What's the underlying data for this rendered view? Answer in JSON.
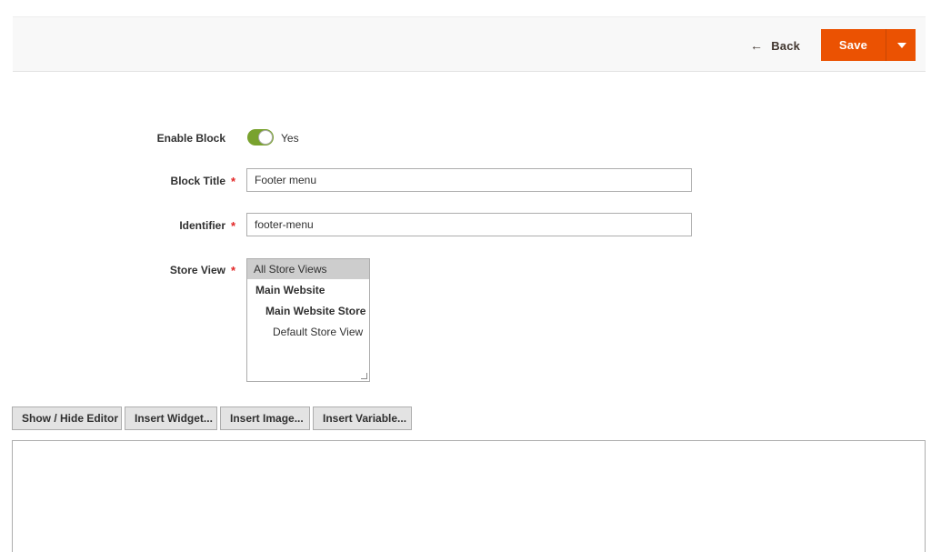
{
  "header": {
    "back_label": "Back",
    "save_label": "Save"
  },
  "form": {
    "enable_block": {
      "label": "Enable Block",
      "value_label": "Yes",
      "enabled": true
    },
    "block_title": {
      "label": "Block Title",
      "required_mark": "*",
      "value": "Footer menu"
    },
    "identifier": {
      "label": "Identifier",
      "required_mark": "*",
      "value": "footer-menu"
    },
    "store_view": {
      "label": "Store View",
      "required_mark": "*",
      "options": [
        {
          "label": "All Store Views",
          "selected": true
        },
        {
          "label": "Main Website"
        },
        {
          "label": "Main Website Store"
        },
        {
          "label": "Default Store View"
        }
      ]
    }
  },
  "editor": {
    "buttons": [
      "Show / Hide Editor",
      "Insert Widget...",
      "Insert Image...",
      "Insert Variable..."
    ]
  },
  "colors": {
    "accent": "#eb5202",
    "toggle_on": "#79a22e",
    "required": "#e22626"
  }
}
